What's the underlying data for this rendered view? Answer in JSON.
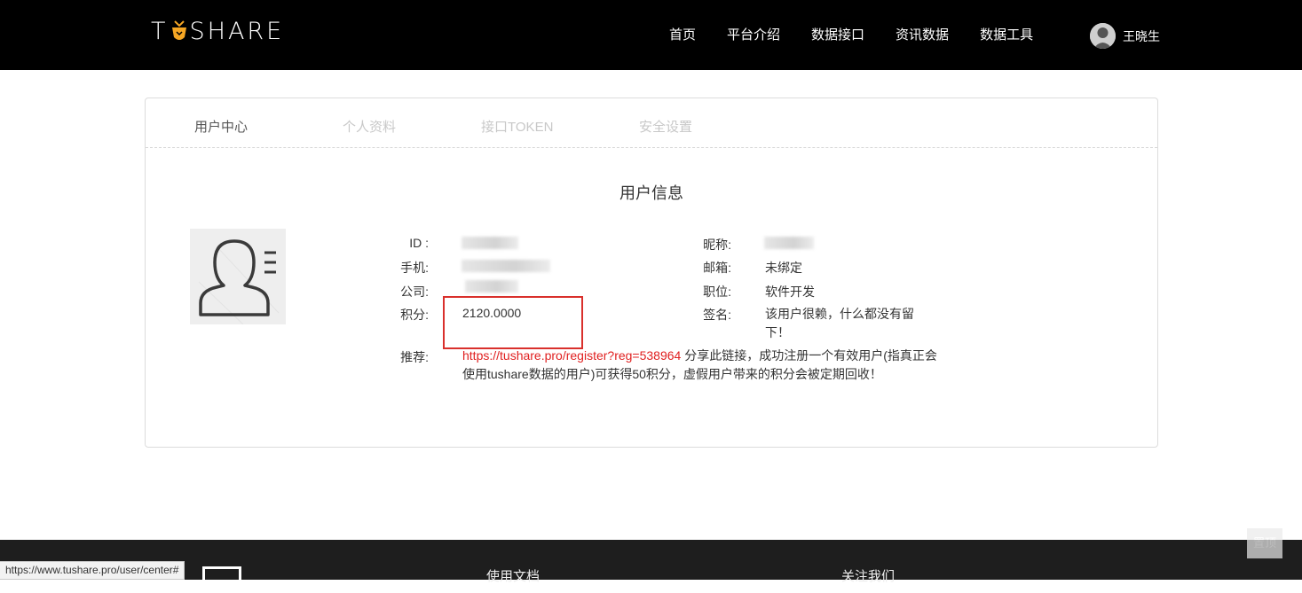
{
  "header": {
    "logo_left": "T",
    "logo_right": "SHARE",
    "nav": [
      "首页",
      "平台介绍",
      "数据接口",
      "资讯数据",
      "数据工具"
    ],
    "user_name": "王晓生"
  },
  "tabs": [
    "用户中心",
    "个人资料",
    "接口TOKEN",
    "安全设置"
  ],
  "card_title": "用户信息",
  "fields": {
    "id_label": "ID :",
    "phone_label": "手机:",
    "company_label": "公司:",
    "points_label": "积分:",
    "points_value": "2120.0000",
    "referral_label": "推荐:",
    "referral_link": "https://tushare.pro/register?reg=538964",
    "referral_text": " 分享此链接，成功注册一个有效用户(指真正会使用tushare数据的用户)可获得50积分，虚假用户带来的积分会被定期回收！",
    "nickname_label": "昵称:",
    "email_label": "邮箱:",
    "email_value": "未绑定",
    "position_label": "职位:",
    "position_value": "软件开发",
    "signature_label": "签名:",
    "signature_value": "该用户很赖，什么都没有留下！"
  },
  "footer": {
    "docs": "使用文档",
    "follow": "关注我们",
    "to_top": "置顶"
  },
  "status_url": "https://www.tushare.pro/user/center#",
  "colors": {
    "header_bg": "#000000",
    "highlight": "#d9302c",
    "link": "#e02020",
    "carrot": "#f5a623"
  }
}
